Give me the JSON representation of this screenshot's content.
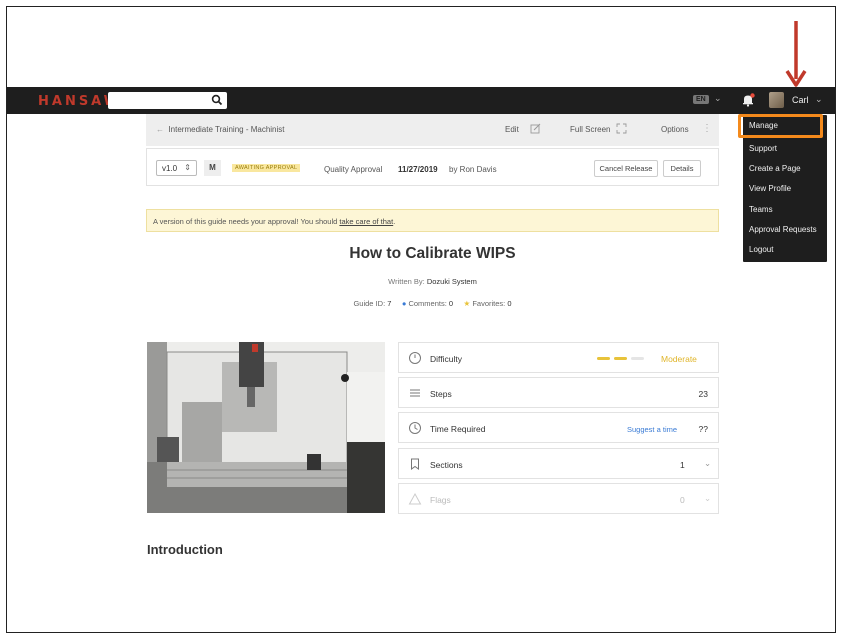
{
  "header": {
    "logo": "HANSAW",
    "search_placeholder": "",
    "language": "EN",
    "user_name": "Carl"
  },
  "dropdown": {
    "items": [
      "Manage",
      "Support",
      "Create a Page",
      "View Profile",
      "Teams",
      "Approval Requests",
      "Logout"
    ]
  },
  "breadcrumb": {
    "back_label": "Intermediate Training - Machinist",
    "edit": "Edit",
    "fullscreen": "Full Screen",
    "options": "Options"
  },
  "version_bar": {
    "version": "v1.0",
    "mode": "M",
    "status": "AWAITING APPROVAL",
    "approval_type": "Quality Approval",
    "date": "11/27/2019",
    "by": "by Ron Davis",
    "cancel_label": "Cancel Release",
    "details_label": "Details"
  },
  "notice": {
    "text": "A version of this guide needs your approval! You should ",
    "link": "take care of that",
    "suffix": "."
  },
  "guide": {
    "title": "How to Calibrate WIPS",
    "written_by_label": "Written By:",
    "author": "Dozuki System",
    "guide_id_label": "Guide ID:",
    "guide_id": "7",
    "comments_label": "Comments:",
    "comments": "0",
    "favorites_label": "Favorites:",
    "favorites": "0"
  },
  "info": {
    "difficulty_label": "Difficulty",
    "difficulty_value": "Moderate",
    "difficulty_level": 2,
    "difficulty_max": 3,
    "steps_label": "Steps",
    "steps_value": "23",
    "time_label": "Time Required",
    "time_link": "Suggest a time",
    "time_value": "??",
    "sections_label": "Sections",
    "sections_value": "1",
    "flags_label": "Flags",
    "flags_value": "0"
  },
  "introduction": "Introduction",
  "colors": {
    "topbar": "#1e1e1e",
    "accent_orange": "#f48a1c",
    "arrow_red": "#c0392b",
    "difficulty_yellow": "#e8c33a"
  }
}
